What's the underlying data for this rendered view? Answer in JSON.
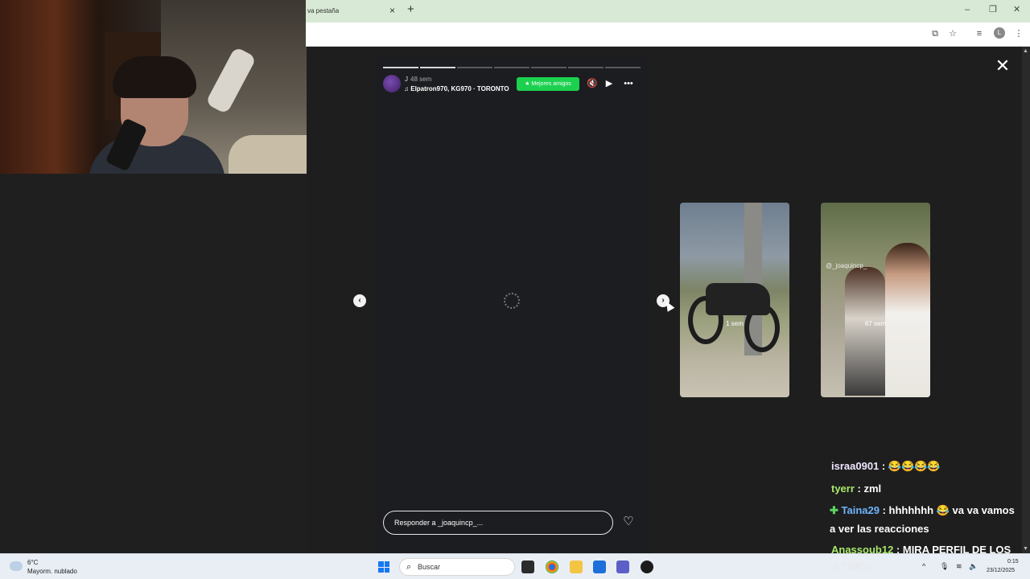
{
  "browser": {
    "tab_title": "va pestaña",
    "tab_close": "×",
    "new_tab": "+",
    "minimize": "–",
    "maximize": "❐",
    "close": "✕",
    "profile_initial": "L"
  },
  "story": {
    "user": "J",
    "time": "48 sem",
    "music": "Elpatron970, KG970 · TORONTO",
    "best_friends_label": "★ Mejores amigos",
    "reply_placeholder": "Responder a _joaquincp_...",
    "progress_segments": 7,
    "progress_done": 2
  },
  "previews": [
    {
      "time": "1 sem"
    },
    {
      "time": "67 sem",
      "mention": "@_joaquincp_"
    }
  ],
  "chat": {
    "messages": [
      {
        "user": "israa0901",
        "text": " : 😂😂😂😂",
        "color": "#f0e5ff"
      },
      {
        "user": "tyerr",
        "text": " : zml",
        "color": "#a8e86b"
      },
      {
        "user": "Taina29",
        "text": " : hhhhhhh 😂 va va vamos",
        "color": "#6fb4ff"
      },
      {
        "user": "",
        "text": "a ver las reacciones",
        "color": "#ffffff"
      },
      {
        "user": "Anassoub12",
        "text": " : MIRA PERFIL DE LOS",
        "color": "#a8e86b"
      }
    ],
    "footer": "ULTIMOS"
  },
  "taskbar": {
    "temperature": "6°C",
    "weather": "Mayorm. nublado",
    "search_placeholder": "Buscar",
    "time": "0:15",
    "date": "23/12/2025"
  },
  "colors": {
    "best_friends": "#1cd14f",
    "overlay": "#1e1e1e",
    "tab_bar": "#d8ead5"
  }
}
